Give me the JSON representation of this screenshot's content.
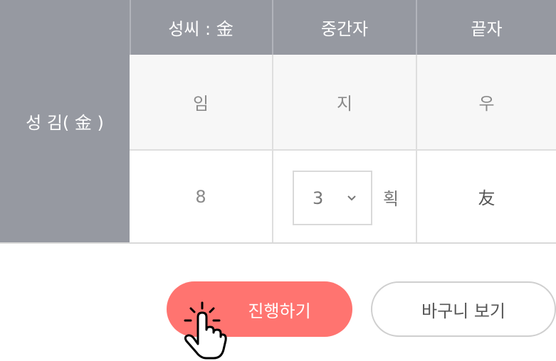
{
  "table": {
    "row_header": "성 김( 金 )",
    "columns": [
      "성씨 : 金",
      "중간자",
      "끝자"
    ],
    "row1": [
      "임",
      "지",
      "우"
    ],
    "row2": {
      "first": "8",
      "middle_select_value": "3",
      "middle_unit": "획",
      "last": "友"
    }
  },
  "buttons": {
    "proceed_label": "진행하기",
    "cart_label": "바구니 보기"
  },
  "icons": {
    "select_chevron": "chevron-down-icon",
    "pointer": "hand-pointer-icon"
  },
  "colors": {
    "header_bg": "#9699a1",
    "primary": "#ff7470"
  }
}
